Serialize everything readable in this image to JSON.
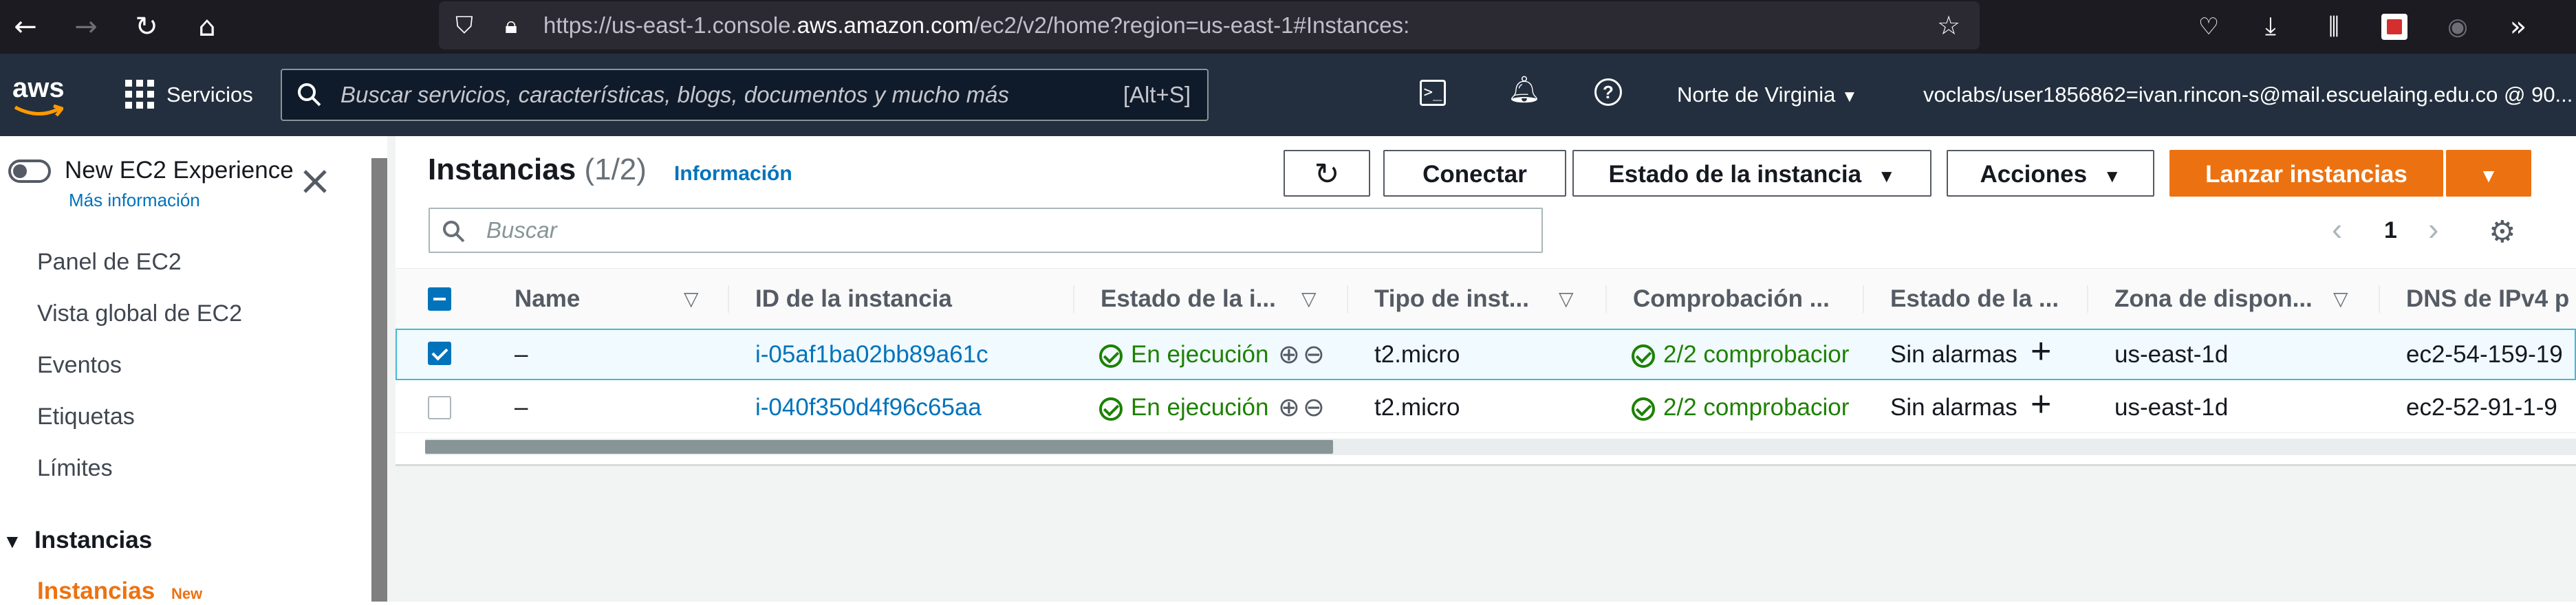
{
  "browser": {
    "url_prefix": "https://us-east-1.console.",
    "url_domain": "aws.amazon.com",
    "url_suffix": "/ec2/v2/home?region=us-east-1#Instances:"
  },
  "aws_nav": {
    "logo": "aws",
    "services_label": "Servicios",
    "search_placeholder": "Buscar servicios, características, blogs, documentos y mucho más",
    "search_shortcut": "[Alt+S]",
    "region_label": "Norte de Virginia",
    "account_label": "voclabs/user1856862=ivan.rincon-s@mail.escuelaing.edu.co @ 90..."
  },
  "sidebar": {
    "new_experience_label": "New EC2 Experience",
    "more_info_link": "Más información",
    "items": [
      "Panel de EC2",
      "Vista global de EC2",
      "Eventos",
      "Etiquetas",
      "Límites"
    ],
    "section_label": "Instancias",
    "active_item_label": "Instancias",
    "active_item_badge": "New"
  },
  "main": {
    "title": "Instancias",
    "count": "(1/2)",
    "info_link": "Información",
    "buttons": {
      "connect": "Conectar",
      "instance_state": "Estado de la instancia",
      "actions": "Acciones",
      "launch": "Lanzar instancias"
    },
    "search_placeholder": "Buscar",
    "page_number": "1"
  },
  "table": {
    "headers": [
      "Name",
      "ID de la instancia",
      "Estado de la i...",
      "Tipo de inst...",
      "Comprobación ...",
      "Estado de la ...",
      "Zona de dispon...",
      "DNS de IPv4 p"
    ],
    "rows": [
      {
        "selected": true,
        "name": "–",
        "id": "i-05af1ba02bb89a61c",
        "state": "En ejecución",
        "type": "t2.micro",
        "check": "2/2 comprobacior",
        "alarm": "Sin alarmas",
        "zone": "us-east-1d",
        "dns": "ec2-54-159-19"
      },
      {
        "selected": false,
        "name": "–",
        "id": "i-040f350d4f96c65aa",
        "state": "En ejecución",
        "type": "t2.micro",
        "check": "2/2 comprobacior",
        "alarm": "Sin alarmas",
        "zone": "us-east-1d",
        "dns": "ec2-52-91-1-9"
      }
    ]
  },
  "colors": {
    "accent": "#ec7211",
    "link": "#0073bb",
    "success": "#1d8102",
    "nav_bg": "#232f3e"
  }
}
